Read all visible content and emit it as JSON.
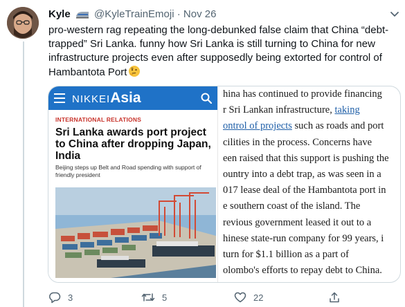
{
  "tweet": {
    "display_name": "Kyle",
    "handle": "@KyleTrainEmoji",
    "separator": "·",
    "date": "Nov 26",
    "text": "pro-western rag repeating the long-debunked false claim that China “debt-trapped” Sri Lanka. funny how Sri Lanka is still turning to China for new infrastructure projects even after supposedly being extorted for control of Hambantota Port",
    "name_emoji": "train-emoji",
    "text_emoji": "thinking-face-emoji"
  },
  "card": {
    "nikkei": {
      "logo_part1": "NIKKEI",
      "logo_part2": "Asia",
      "section": "INTERNATIONAL RELATIONS",
      "headline": "Sri Lanka awards port project to China after dropping Japan, India",
      "subheadline": "Beijing steps up Belt and Road spending with support of friendly president"
    },
    "article": {
      "lines": [
        "hina has continued to provide financing",
        "r Sri Lankan infrastructure, ",
        "ontrol of projects",
        " such as roads and port",
        "cilities in the process. Concerns have",
        "een raised that this support is pushing the",
        "ountry into a debt trap, as was seen in a",
        "017 lease deal of the Hambantota port in",
        "e southern coast of the island. The",
        "revious government leased it out to a",
        "hinese state-run company for 99 years, i",
        "turn for $1.1 billion as a part of",
        "olombo's efforts to repay debt to China."
      ],
      "link_part1": "taking"
    }
  },
  "actions": {
    "replies": "3",
    "retweets": "5",
    "likes": "22"
  },
  "colors": {
    "nikkei_blue": "#1f72c7",
    "section_red": "#c8332b",
    "link_blue": "#1f5fa8",
    "muted_text": "#536471"
  }
}
